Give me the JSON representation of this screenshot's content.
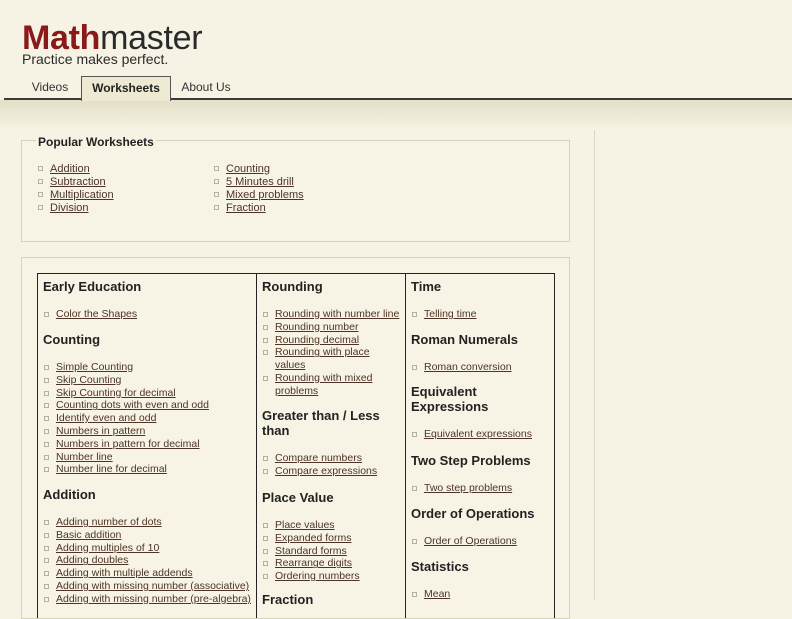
{
  "brand": {
    "logo_bold": "Math",
    "logo_light": "master",
    "tagline": "Practice makes perfect."
  },
  "tabs": [
    {
      "label": "Videos",
      "active": false
    },
    {
      "label": "Worksheets",
      "active": true
    },
    {
      "label": "About Us",
      "active": false
    }
  ],
  "popular": {
    "title": "Popular Worksheets",
    "left": [
      "Addition",
      "Subtraction",
      "Multiplication",
      "Division"
    ],
    "right": [
      "Counting",
      "5 Minutes drill",
      "Mixed problems",
      "Fraction"
    ]
  },
  "categories": {
    "col1": [
      {
        "title": "Early Education",
        "items": [
          "Color the Shapes"
        ]
      },
      {
        "title": "Counting",
        "items": [
          "Simple Counting",
          "Skip Counting",
          "Skip Counting for decimal",
          "Counting dots with even and odd",
          "Identify even and odd",
          "Numbers in pattern",
          "Numbers in pattern for decimal",
          "Number line",
          "Number line for decimal"
        ]
      },
      {
        "title": "Addition",
        "items": [
          "Adding number of dots",
          "Basic addition",
          "Adding multiples of 10",
          "Adding doubles",
          "Adding with multiple addends",
          "Adding with missing number (associative)",
          "Adding with missing number (pre-algebra)"
        ]
      }
    ],
    "col2": [
      {
        "title": "Rounding",
        "items": [
          "Rounding with number line",
          "Rounding number",
          "Rounding decimal",
          "Rounding with place values",
          "Rounding with mixed problems"
        ]
      },
      {
        "title": "Greater than / Less than",
        "items": [
          "Compare numbers",
          "Compare expressions"
        ]
      },
      {
        "title": "Place Value",
        "items": [
          "Place values",
          "Expanded forms",
          "Standard forms",
          "Rearrange digits",
          "Ordering numbers"
        ]
      },
      {
        "title": "Fraction",
        "items": []
      }
    ],
    "col3": [
      {
        "title": "Time",
        "items": [
          "Telling time"
        ]
      },
      {
        "title": "Roman Numerals",
        "items": [
          "Roman conversion"
        ]
      },
      {
        "title": "Equivalent Expressions",
        "items": [
          "Equivalent expressions"
        ]
      },
      {
        "title": "Two Step Problems",
        "items": [
          "Two step problems"
        ]
      },
      {
        "title": "Order of Operations",
        "items": [
          "Order of Operations"
        ]
      },
      {
        "title": "Statistics",
        "items": [
          "Mean"
        ]
      }
    ]
  },
  "colors": {
    "logo_accent": "#8a1a1a",
    "link": "#4d3426",
    "background": "#f6f3e4"
  }
}
